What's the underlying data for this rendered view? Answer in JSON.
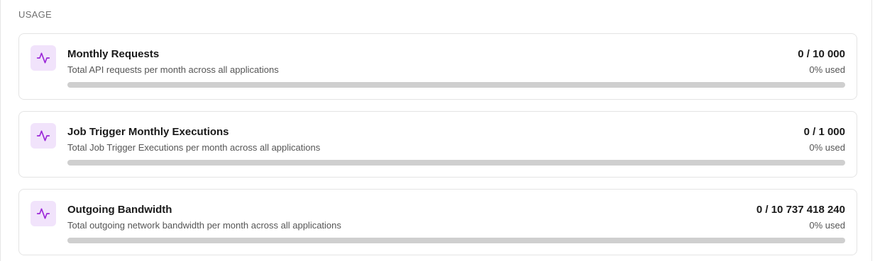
{
  "section": {
    "title": "USAGE"
  },
  "colors": {
    "accent": "#9b27d8",
    "icon_bg": "#f1e3fb",
    "track": "#cfcfcf"
  },
  "cards": [
    {
      "icon": "activity-icon",
      "title": "Monthly Requests",
      "description": "Total API requests per month across all applications",
      "count": "0 / 10 000",
      "used": "0% used",
      "progress_percent": 0
    },
    {
      "icon": "activity-icon",
      "title": "Job Trigger Monthly Executions",
      "description": "Total Job Trigger Executions per month across all applications",
      "count": "0 / 1 000",
      "used": "0% used",
      "progress_percent": 0
    },
    {
      "icon": "activity-icon",
      "title": "Outgoing Bandwidth",
      "description": "Total outgoing network bandwidth per month across all applications",
      "count": "0 / 10 737 418 240",
      "used": "0% used",
      "progress_percent": 0
    }
  ]
}
